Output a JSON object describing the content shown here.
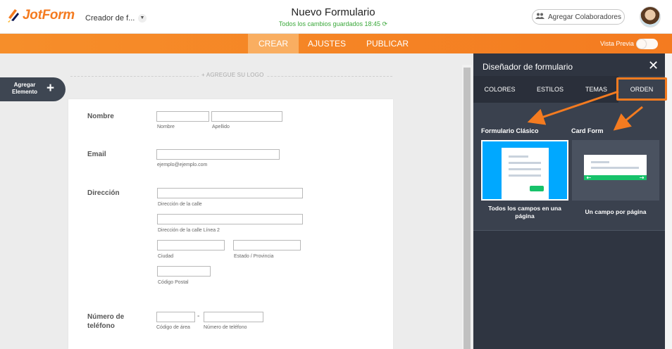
{
  "brand": {
    "name": "JotForm",
    "accent": "#f47b20"
  },
  "header": {
    "creator_label": "Creador de f...",
    "form_title": "Nuevo Formulario",
    "saved_status": "Todos los cambios guardados 18:45",
    "collab_label": "Agregar Colaboradores"
  },
  "nav": {
    "tabs": [
      {
        "label": "CREAR"
      },
      {
        "label": "AJUSTES"
      },
      {
        "label": "PUBLICAR"
      }
    ],
    "active_tab": "CREAR",
    "preview_label": "Vista Previa"
  },
  "canvas": {
    "add_element_label": "Agregar Elemento",
    "add_logo_label": "+ AGREGUE SU LOGO"
  },
  "form": {
    "name": {
      "label": "Nombre",
      "sub_first": "Nombre",
      "sub_last": "Apellido"
    },
    "email": {
      "label": "Email",
      "sub": "ejemplo@ejemplo.com"
    },
    "address": {
      "label": "Dirección",
      "sub_street": "Dirección de la calle",
      "sub_street2": "Dirección de la calle Línea 2",
      "sub_city": "Ciudad",
      "sub_state": "Estado / Provincia",
      "sub_zip": "Código Postal"
    },
    "phone": {
      "label": "Número de teléfono",
      "separator": "-",
      "sub_area": "Código de área",
      "sub_number": "Número de teléfono"
    }
  },
  "panel": {
    "title": "Diseñador de formulario",
    "tabs": [
      {
        "label": "COLORES"
      },
      {
        "label": "ESTILOS"
      },
      {
        "label": "TEMAS"
      },
      {
        "label": "ORDEN"
      }
    ],
    "active_tab": "ORDEN",
    "classic": {
      "title": "Formulario Clásico",
      "desc": "Todos los campos en una página"
    },
    "card": {
      "title": "Card Form",
      "desc": "Un campo por página"
    }
  },
  "colors": {
    "panel_bg": "#2f3541",
    "classic_bg": "#00a8ff",
    "green": "#17c26a",
    "annotation": "#f47b20"
  }
}
